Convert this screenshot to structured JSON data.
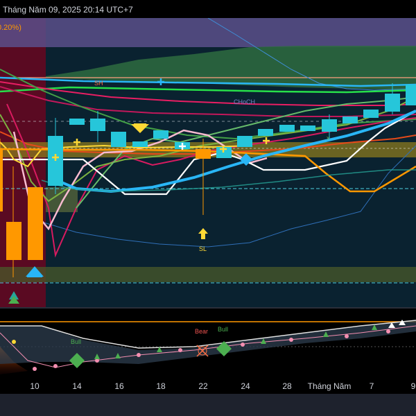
{
  "header": {
    "datetime": "Tháng Năm 09, 2025 20:14 UTC+7",
    "change_fragment": "0.20%)"
  },
  "labels": {
    "sh": "SH",
    "choch": "CHoCH",
    "sl": "SL",
    "x_mark": "x",
    "osc_bull_left": "Bull",
    "osc_bear": "Bear",
    "osc_bull_right": "Bull"
  },
  "time_axis": [
    "10",
    "14",
    "16",
    "18",
    "22",
    "24",
    "28",
    "Tháng Năm",
    "7",
    "9"
  ],
  "colors": {
    "background": "#0a2230",
    "bull_candle": "#26c6da",
    "bear_candle": "#ff9800",
    "session_highlight": "#5a0a22"
  }
}
